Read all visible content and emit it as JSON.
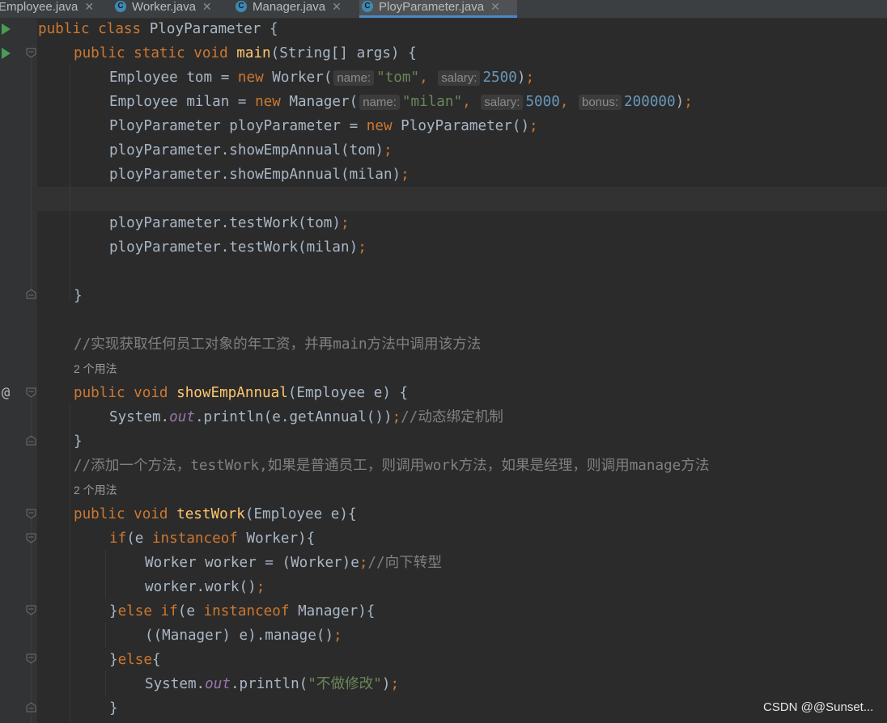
{
  "tabs": [
    {
      "label": "Employee.java"
    },
    {
      "label": "Worker.java"
    },
    {
      "label": "Manager.java"
    },
    {
      "label": "PloyParameter.java",
      "active": true
    }
  ],
  "code": {
    "l1": {
      "kw": "public class ",
      "name": "PloyParameter {"
    },
    "l2": {
      "kw": "public static void ",
      "fn": "main",
      "rest": "(String[] args) {"
    },
    "l3": {
      "a": "Employee tom = ",
      "kw": "new ",
      "b": "Worker(",
      "h1": "name:",
      "s1": "\"tom\"",
      "c": ",",
      "h2": "salary:",
      "n1": "2500",
      "d": ")",
      "semi": ";"
    },
    "l4": {
      "a": "Employee milan = ",
      "kw": "new ",
      "b": "Manager(",
      "h1": "name:",
      "s1": "\"milan\"",
      "c": ",",
      "h2": "salary:",
      "n1": "5000",
      "c2": ",",
      "h3": "bonus:",
      "n2": "200000",
      "d": ")",
      "semi": ";"
    },
    "l5": {
      "a": "PloyParameter ployParameter = ",
      "kw": "new ",
      "b": "PloyParameter()",
      "semi": ";"
    },
    "l6": {
      "a": "ployParameter.showEmpAnnual(tom)",
      "semi": ";"
    },
    "l7": {
      "a": "ployParameter.showEmpAnnual(milan)",
      "semi": ";"
    },
    "l9": {
      "a": "ployParameter.testWork(tom)",
      "semi": ";"
    },
    "l10": {
      "a": "ployParameter.testWork(milan)",
      "semi": ";"
    },
    "l12": {
      "a": "}"
    },
    "c1": "//实现获取任何员工对象的年工资，并再main方法中调用该方法",
    "u1": "2 个用法",
    "l15": {
      "kw": "public void ",
      "fn": "showEmpAnnual",
      "rest": "(Employee e) {"
    },
    "l16": {
      "a": "System.",
      "f": "out",
      "b": ".println(e.getAnnual())",
      "semi": ";",
      "cmt": "//动态绑定机制"
    },
    "l17": {
      "a": "}"
    },
    "c2": "//添加一个方法，testWork,如果是普通员工，则调用work方法，如果是经理，则调用manage方法",
    "u2": "2 个用法",
    "l20": {
      "kw": "public void ",
      "fn": "testWork",
      "rest": "(Employee e){"
    },
    "l21": {
      "kw1": "if",
      "a": "(e ",
      "kw2": "instanceof ",
      "b": "Worker){"
    },
    "l22": {
      "a": "Worker worker = (Worker)e",
      "semi": ";",
      "cmt": "//向下转型"
    },
    "l23": {
      "a": "worker.work()",
      "semi": ";"
    },
    "l24": {
      "a": "}",
      "kw1": "else if",
      "b": "(e ",
      "kw2": "instanceof ",
      "c": "Manager){"
    },
    "l25": {
      "a": "((Manager) e).manage()",
      "semi": ";"
    },
    "l26": {
      "a": "}",
      "kw": "else",
      "b": "{"
    },
    "l27": {
      "a": "System.",
      "f": "out",
      "b": ".println(",
      "s": "\"不做修改\"",
      "c": ")",
      "semi": ";"
    },
    "l28": {
      "a": "}"
    }
  },
  "watermark": "CSDN @@Sunset...",
  "colors": {
    "background": "#2b2b2b",
    "keyword": "#cc7832",
    "function": "#ffc66d",
    "string": "#6a8759",
    "number": "#6897bb",
    "comment": "#808080"
  }
}
